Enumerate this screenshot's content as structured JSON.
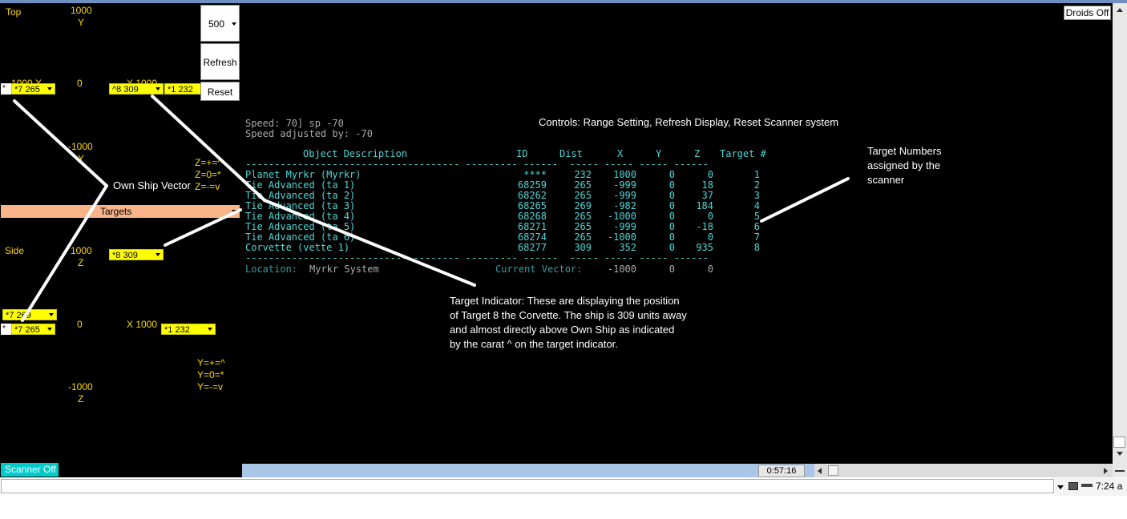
{
  "top_panel": {
    "top_label": "Top",
    "y_max": "1000",
    "y_label": "Y",
    "y_min": "-1000",
    "y_min_label": "Y",
    "zero": "0",
    "neg_axis_label": "-1000 X",
    "pos_axis_label": "X 1000",
    "select_left": "*7 265",
    "select_right1": "^8 309",
    "select_right2": "*1 232",
    "star": "*",
    "legend": [
      "Z=+=^",
      "Z=0=*",
      "Z=-=v"
    ]
  },
  "side_panel": {
    "side_label": "Side",
    "z_max": "1000",
    "z_label": "Z",
    "z_min": "-1000",
    "z_min_label": "Z",
    "zero": "0",
    "pos_axis_label": "X 1000",
    "select_top": "*8 309",
    "select_left1": "*7 269",
    "select_left2": "*7 265",
    "select_right": "*1 232",
    "star": "*",
    "legend": [
      "Y=+=^",
      "Y=0=*",
      "Y=-=v"
    ]
  },
  "controls": {
    "range_value": "500",
    "refresh_label": "Refresh",
    "reset_label": "Reset"
  },
  "targets_bar_label": "Targets",
  "droids_button": "Droids Off",
  "scanner_button": "Scanner Off",
  "status_time": "0:57:16",
  "tray_time": "7:24 a",
  "speed_line1": "Speed: 70] sp -70",
  "speed_line2": "Speed adjusted by: -70",
  "table": {
    "headers": {
      "desc": "Object Description",
      "id": "ID",
      "dist": "Dist",
      "x": "X",
      "y": "Y",
      "z": "Z",
      "target": "Target #"
    },
    "rows": [
      {
        "desc": "Planet Myrkr (Myrkr)",
        "id": "****",
        "dist": "232",
        "x": "1000",
        "y": "0",
        "z": "0",
        "t": "1"
      },
      {
        "desc": "Tie Advanced (ta 1)",
        "id": "68259",
        "dist": "265",
        "x": "-999",
        "y": "0",
        "z": "18",
        "t": "2"
      },
      {
        "desc": "Tie Advanced (ta 2)",
        "id": "68262",
        "dist": "265",
        "x": "-999",
        "y": "0",
        "z": "37",
        "t": "3"
      },
      {
        "desc": "Tie Advanced (ta 3)",
        "id": "68265",
        "dist": "269",
        "x": "-982",
        "y": "0",
        "z": "184",
        "t": "4"
      },
      {
        "desc": "Tie Advanced (ta 4)",
        "id": "68268",
        "dist": "265",
        "x": "-1000",
        "y": "0",
        "z": "0",
        "t": "5"
      },
      {
        "desc": "Tie Advanced (ta 5)",
        "id": "68271",
        "dist": "265",
        "x": "-999",
        "y": "0",
        "z": "-18",
        "t": "6"
      },
      {
        "desc": "Tie Advanced (ta 6)",
        "id": "68274",
        "dist": "265",
        "x": "-1000",
        "y": "0",
        "z": "0",
        "t": "7"
      },
      {
        "desc": "Corvette (vette 1)",
        "id": "68277",
        "dist": "309",
        "x": "352",
        "y": "0",
        "z": "935",
        "t": "8"
      }
    ],
    "location_label": "Location:",
    "location_value": "Myrkr System",
    "vector_label": "Current Vector:",
    "vector_x": "-1000",
    "vector_y": "0",
    "vector_z": "0"
  },
  "annotations": {
    "controls_note": "Controls: Range Setting, Refresh Display, Reset Scanner system",
    "own_ship_note": "Own Ship Vector",
    "target_numbers_note": [
      "Target Numbers",
      "assigned by the",
      "scanner"
    ],
    "indicator_note": [
      "Target Indicator:  These are displaying the position",
      "of Target 8 the Corvette.  The ship is 309 units away",
      "and almost directly above Own Ship as indicated",
      "by the carat ^ on the target indicator."
    ]
  },
  "colors": {
    "accent_yellow": "#ffff00",
    "label_yellow": "#ffd800",
    "cyan": "#4fd6d6",
    "targets_bar": "#f9b48a",
    "scanner_btn": "#00cccc"
  }
}
